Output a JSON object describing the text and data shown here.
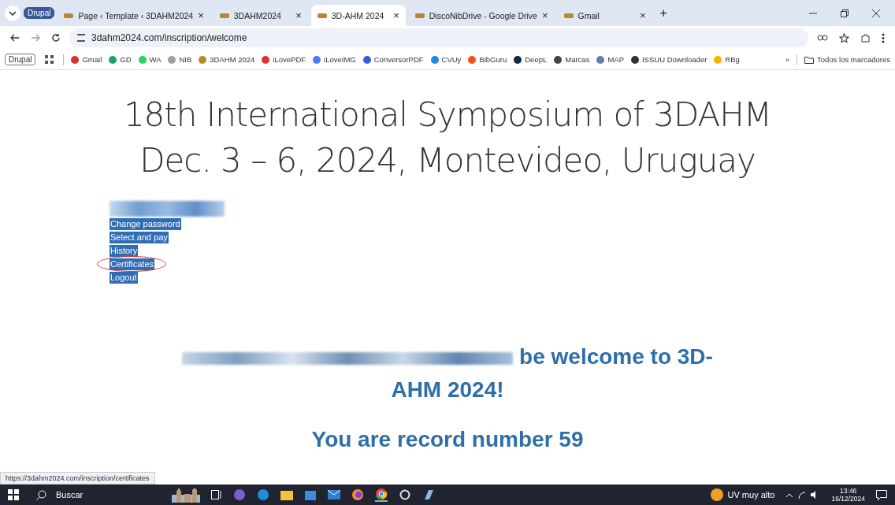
{
  "profile_chip": "Drupal",
  "tabs": [
    {
      "title": "Page ‹ Template ‹ 3DAHM2024",
      "close": "×",
      "selected": false
    },
    {
      "title": "3DAHM2024",
      "close": "×",
      "selected": false
    },
    {
      "title": "3D-AHM 2024",
      "close": "×",
      "selected": true
    },
    {
      "title": "DiscoNibDrive - Google Drive",
      "close": "×",
      "selected": false
    },
    {
      "title": "Gmail",
      "close": "×",
      "selected": false
    }
  ],
  "new_tab": "+",
  "address": "3dahm2024.com/inscription/welcome",
  "bookmarks_chip": "Drupal",
  "bookmarks": [
    {
      "label": "Gmail",
      "color": "#d93025"
    },
    {
      "label": "GD",
      "color": "#1fa463"
    },
    {
      "label": "WA",
      "color": "#25d366"
    },
    {
      "label": "NIB",
      "color": "#9aa0a6"
    },
    {
      "label": "3DAHM 2024",
      "color": "#b38b2d"
    },
    {
      "label": "iLovePDF",
      "color": "#e5322d"
    },
    {
      "label": "iLoveIMG",
      "color": "#4a7aff"
    },
    {
      "label": "ConversorPDF",
      "color": "#3b5bdb"
    },
    {
      "label": "CVUy",
      "color": "#1e88e5"
    },
    {
      "label": "BibGuru",
      "color": "#f4511e"
    },
    {
      "label": "DeepL",
      "color": "#0f2b46"
    },
    {
      "label": "Marcas",
      "color": "#444444"
    },
    {
      "label": "MAP",
      "color": "#5f7fa8"
    },
    {
      "label": "ISSUU Downloader",
      "color": "#333333"
    },
    {
      "label": "RBg",
      "color": "#f4b400"
    }
  ],
  "bookmarks_more": "»",
  "all_bookmarks": "Todos los marcadores",
  "heading": [
    "18th International Symposium of 3DAHM",
    "Dec. 3 – 6, 2024, Montevideo, Uruguay"
  ],
  "menu": [
    {
      "label": "Change password",
      "selected": true,
      "circled": false
    },
    {
      "label": "Select and pay",
      "selected": true,
      "circled": false
    },
    {
      "label": "History",
      "selected": true,
      "circled": false
    },
    {
      "label": "Certificates",
      "selected": true,
      "circled": true
    },
    {
      "label": "Logout",
      "selected": true,
      "circled": false
    }
  ],
  "welcome": "be welcome to 3D-AHM 2024!",
  "record": "You are record number 59",
  "status_url": "https://3dahm2024.com/inscription/certificates",
  "taskbar": {
    "search": "Buscar",
    "weather": "UV muy alto",
    "time": "13:46",
    "date": "16/12/2024"
  }
}
